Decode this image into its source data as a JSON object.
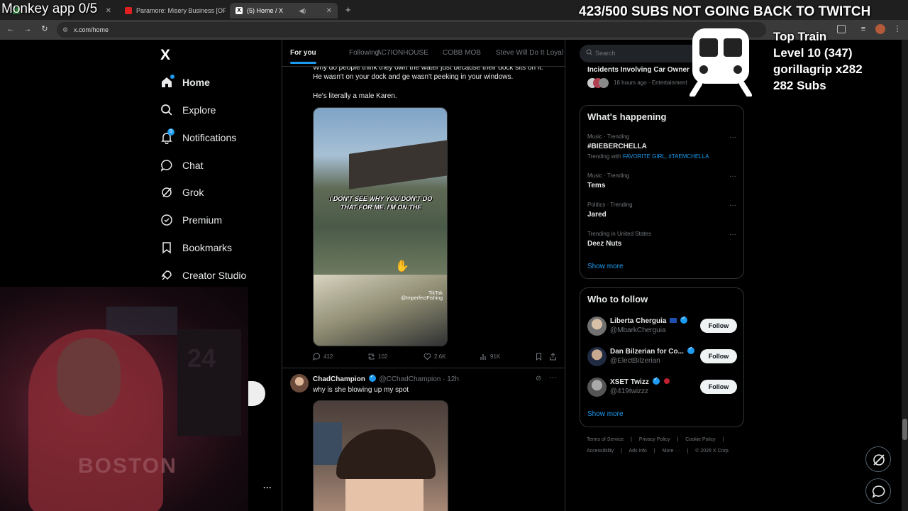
{
  "browser": {
    "tabs": [
      {
        "label": "Monkey app 0/5"
      },
      {
        "label": "Paramore: Misery Business [OFF"
      },
      {
        "label": "(5) Home / X"
      }
    ],
    "url": "x.com/home"
  },
  "overlay": {
    "left_text": "Monkey app 0/5",
    "right_text": "423/500 SUBS NOT GOING BACK TO TWITCH",
    "train": {
      "title": "Top Train",
      "level": "Level 10  (347)",
      "grip": "gorillagrip x282",
      "subs": "282 Subs"
    }
  },
  "sidebar": {
    "logo": "X",
    "items": [
      {
        "label": "Home"
      },
      {
        "label": "Explore"
      },
      {
        "label": "Notifications"
      },
      {
        "label": "Chat"
      },
      {
        "label": "Grok"
      },
      {
        "label": "Premium"
      },
      {
        "label": "Bookmarks"
      },
      {
        "label": "Creator Studio"
      }
    ],
    "notification_count": "5"
  },
  "timeline": {
    "tabs": [
      "For you",
      "Following",
      "AC7IONHOUSE",
      "COBB MOB",
      "Steve Will Do It Loyal"
    ],
    "tweet1": {
      "text_line1": "Why do people think they own the water just because their dock sits on it.",
      "text_line2": "He wasn't on your dock and ge wasn't peeking in your windows.",
      "text_line3": "He's literally a male Karen.",
      "video_caption": "I DON'T SEE WHY YOU DON'T DO THAT FOR ME. I'M ON THE",
      "tiktok": "TikTok",
      "tiktok_handle": "@ImperfectFishing",
      "replies": "412",
      "reposts": "102",
      "likes": "2.6K",
      "views": "91K"
    },
    "tweet2": {
      "name": "ChadChampion",
      "handle": "@CChadChampion",
      "time": "· 12h",
      "text": "why is she blowing up my spot"
    }
  },
  "right": {
    "search_placeholder": "Search",
    "partial_title": "Incidents Involving Car Owner",
    "partial_meta": "16 hours ago · Entertainment",
    "whats_happening": {
      "title": "What's happening",
      "trends": [
        {
          "category": "Music · Trending",
          "name": "#BIEBERCHELLA",
          "with_label": "Trending with",
          "with_tags": "FAVORITE GIRL, #TAEMCHELLA"
        },
        {
          "category": "Music · Trending",
          "name": "Tems"
        },
        {
          "category": "Politics · Trending",
          "name": "Jared"
        },
        {
          "category": "Trending in United States",
          "name": "Deez Nuts"
        }
      ],
      "show_more": "Show more"
    },
    "who_to_follow": {
      "title": "Who to follow",
      "accounts": [
        {
          "name": "Liberta Cherguia",
          "handle": "@MbarkCherguia",
          "button": "Follow"
        },
        {
          "name": "Dan Bilzerian for Co...",
          "handle": "@ElectBilzerian",
          "button": "Follow"
        },
        {
          "name": "XSET Twizz",
          "handle": "@419twizzz",
          "button": "Follow"
        }
      ],
      "show_more": "Show more"
    },
    "footer": {
      "row1": [
        "Terms of Service",
        "Privacy Policy",
        "Cookie Policy"
      ],
      "row2": [
        "Accessibility",
        "Ads info",
        "More ···",
        "© 2026 X Corp."
      ]
    }
  },
  "colors": {
    "accent": "#1d9bf0",
    "background": "#000000",
    "border": "#2f3336"
  }
}
